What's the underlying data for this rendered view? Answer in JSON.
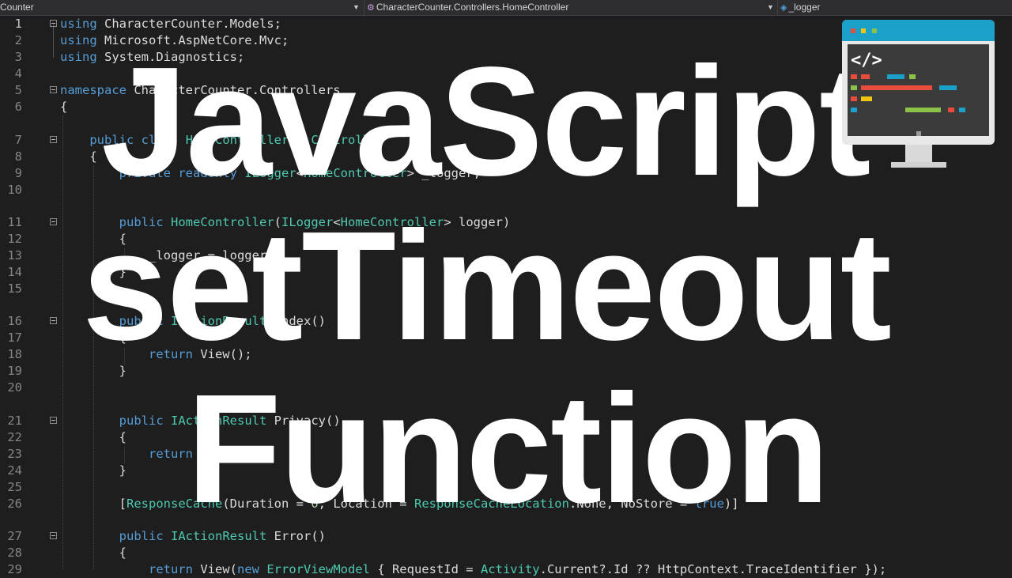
{
  "topbar": {
    "project": "Counter",
    "class_path": "CharacterCounter.Controllers.HomeController",
    "member": "_logger"
  },
  "title": {
    "line1": "JavaScript",
    "line2": "setTimeout",
    "line3": "Function"
  },
  "colors": {
    "background": "#1e1e1e",
    "keyword": "#569cd6",
    "type": "#4ec9b0",
    "number": "#b5cea8",
    "text": "#dcdcdc",
    "overlay_text": "#ffffff"
  },
  "logo": {
    "icon": "code-monitor-icon",
    "symbol": "</>"
  },
  "code_lines": [
    {
      "n": "1",
      "tokens": [
        [
          "kw",
          "using"
        ],
        [
          "t",
          " CharacterCounter.Models;"
        ]
      ]
    },
    {
      "n": "2",
      "tokens": [
        [
          "kw",
          "using"
        ],
        [
          "t",
          " Microsoft.AspNetCore.Mvc;"
        ]
      ]
    },
    {
      "n": "3",
      "tokens": [
        [
          "kw",
          "using"
        ],
        [
          "t",
          " System.Diagnostics;"
        ]
      ]
    },
    {
      "n": "4",
      "tokens": []
    },
    {
      "n": "5",
      "tokens": [
        [
          "kw",
          "namespace"
        ],
        [
          "t",
          " CharacterCounter.Controllers"
        ]
      ]
    },
    {
      "n": "6",
      "tokens": [
        [
          "t",
          "{"
        ]
      ]
    },
    {
      "n": "7",
      "tokens": [
        [
          "t",
          "    "
        ],
        [
          "kw",
          "public"
        ],
        [
          "t",
          " "
        ],
        [
          "kw",
          "class"
        ],
        [
          "t",
          " "
        ],
        [
          "ty",
          "HomeController"
        ],
        [
          "t",
          " : "
        ],
        [
          "ty",
          "Controller"
        ]
      ]
    },
    {
      "n": "8",
      "tokens": [
        [
          "t",
          "    {"
        ]
      ]
    },
    {
      "n": "9",
      "tokens": [
        [
          "t",
          "        "
        ],
        [
          "kw",
          "private"
        ],
        [
          "t",
          " "
        ],
        [
          "kw",
          "readonly"
        ],
        [
          "t",
          " "
        ],
        [
          "ty",
          "ILogger"
        ],
        [
          "t",
          "<"
        ],
        [
          "ty",
          "HomeController"
        ],
        [
          "t",
          "> _logger;"
        ]
      ]
    },
    {
      "n": "10",
      "tokens": []
    },
    {
      "n": "11",
      "tokens": [
        [
          "t",
          "        "
        ],
        [
          "kw",
          "public"
        ],
        [
          "t",
          " "
        ],
        [
          "ty",
          "HomeController"
        ],
        [
          "t",
          "("
        ],
        [
          "ty",
          "ILogger"
        ],
        [
          "t",
          "<"
        ],
        [
          "ty",
          "HomeController"
        ],
        [
          "t",
          "> logger)"
        ]
      ]
    },
    {
      "n": "12",
      "tokens": [
        [
          "t",
          "        {"
        ]
      ]
    },
    {
      "n": "13",
      "tokens": [
        [
          "t",
          "            _logger = logger;"
        ]
      ]
    },
    {
      "n": "14",
      "tokens": [
        [
          "t",
          "        }"
        ]
      ]
    },
    {
      "n": "15",
      "tokens": []
    },
    {
      "n": "16",
      "tokens": [
        [
          "t",
          "        "
        ],
        [
          "kw",
          "public"
        ],
        [
          "t",
          " "
        ],
        [
          "ty",
          "IActionResult"
        ],
        [
          "t",
          " Index()"
        ]
      ]
    },
    {
      "n": "17",
      "tokens": [
        [
          "t",
          "        {"
        ]
      ]
    },
    {
      "n": "18",
      "tokens": [
        [
          "t",
          "            "
        ],
        [
          "kw",
          "return"
        ],
        [
          "t",
          " View();"
        ]
      ]
    },
    {
      "n": "19",
      "tokens": [
        [
          "t",
          "        }"
        ]
      ]
    },
    {
      "n": "20",
      "tokens": []
    },
    {
      "n": "21",
      "tokens": [
        [
          "t",
          "        "
        ],
        [
          "kw",
          "public"
        ],
        [
          "t",
          " "
        ],
        [
          "ty",
          "IActionResult"
        ],
        [
          "t",
          " Privacy()"
        ]
      ]
    },
    {
      "n": "22",
      "tokens": [
        [
          "t",
          "        {"
        ]
      ]
    },
    {
      "n": "23",
      "tokens": [
        [
          "t",
          "            "
        ],
        [
          "kw",
          "return"
        ],
        [
          "t",
          " View();"
        ]
      ]
    },
    {
      "n": "24",
      "tokens": [
        [
          "t",
          "        }"
        ]
      ]
    },
    {
      "n": "25",
      "tokens": []
    },
    {
      "n": "26",
      "tokens": [
        [
          "t",
          "        ["
        ],
        [
          "ty",
          "ResponseCache"
        ],
        [
          "t",
          "(Duration = "
        ],
        [
          "nm",
          "0"
        ],
        [
          "t",
          ", Location = "
        ],
        [
          "ty",
          "ResponseCacheLocation"
        ],
        [
          "t",
          ".None, NoStore = "
        ],
        [
          "kw",
          "true"
        ],
        [
          "t",
          ")]"
        ]
      ]
    },
    {
      "n": "27",
      "tokens": [
        [
          "t",
          "        "
        ],
        [
          "kw",
          "public"
        ],
        [
          "t",
          " "
        ],
        [
          "ty",
          "IActionResult"
        ],
        [
          "t",
          " Error()"
        ]
      ]
    },
    {
      "n": "28",
      "tokens": [
        [
          "t",
          "        {"
        ]
      ]
    },
    {
      "n": "29",
      "tokens": [
        [
          "t",
          "            "
        ],
        [
          "kw",
          "return"
        ],
        [
          "t",
          " View("
        ],
        [
          "kw",
          "new"
        ],
        [
          "t",
          " "
        ],
        [
          "ty",
          "ErrorViewModel"
        ],
        [
          "t",
          " { RequestId = "
        ],
        [
          "ty",
          "Activity"
        ],
        [
          "t",
          ".Current?.Id ?? HttpContext.TraceIdentifier });"
        ]
      ]
    }
  ]
}
